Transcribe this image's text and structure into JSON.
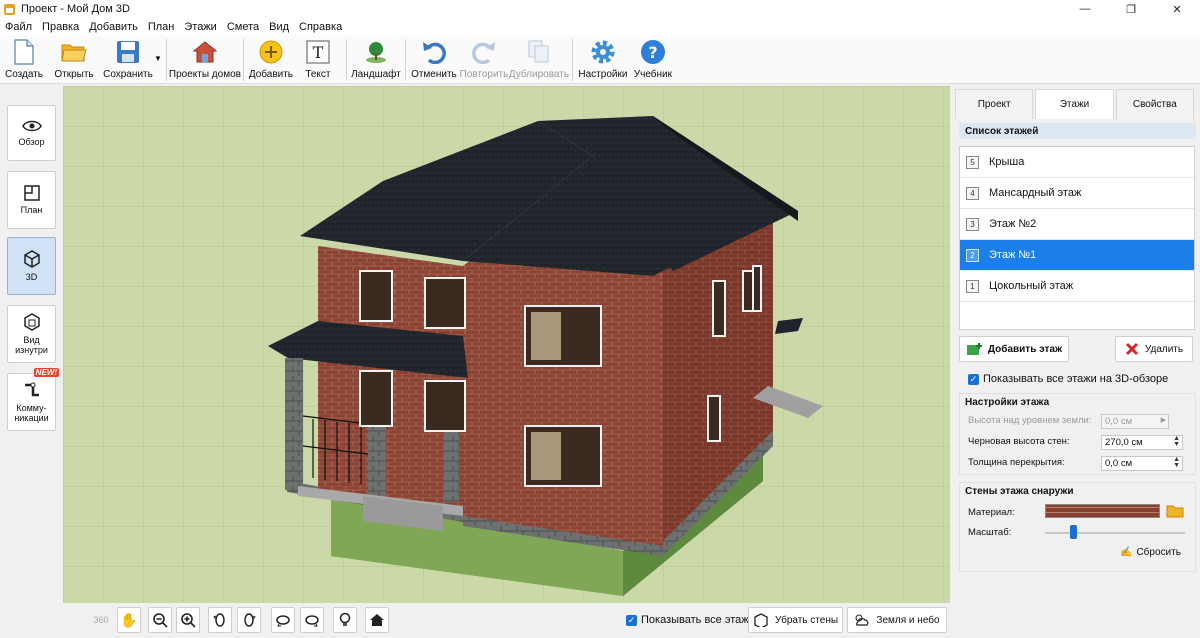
{
  "window": {
    "title": "Проект - Мой Дом 3D"
  },
  "menu": [
    "Файл",
    "Правка",
    "Добавить",
    "План",
    "Этажи",
    "Смета",
    "Вид",
    "Справка"
  ],
  "toolbar": {
    "create": "Создать",
    "open": "Открыть",
    "save": "Сохранить",
    "house_projects": "Проекты домов",
    "add": "Добавить",
    "text": "Текст",
    "landscape": "Ландшафт",
    "undo": "Отменить",
    "redo": "Повторить",
    "duplicate": "Дублировать",
    "settings": "Настройки",
    "tutorial": "Учебник"
  },
  "left_panel": {
    "overview": "Обзор",
    "plan": "План",
    "view3d": "3D",
    "inside_line1": "Вид",
    "inside_line2": "изнутри",
    "comm_line1": "Комму-",
    "comm_line2": "никации",
    "new_badge": "NEW!"
  },
  "bottom_bar": {
    "show_all_floors": "Показывать все этажи",
    "remove_walls": "Убрать стены",
    "ground_sky": "Земля и небо"
  },
  "right_panel": {
    "tabs": [
      "Проект",
      "Этажи",
      "Свойства"
    ],
    "active_tab": "Этажи",
    "floor_list_title": "Список этажей",
    "floors": [
      {
        "num": "5",
        "name": "Крыша"
      },
      {
        "num": "4",
        "name": "Мансардный этаж"
      },
      {
        "num": "3",
        "name": "Этаж №2"
      },
      {
        "num": "2",
        "name": "Этаж №1"
      },
      {
        "num": "1",
        "name": "Цокольный этаж"
      }
    ],
    "selected_floor": "Этаж №1",
    "add_floor": "Добавить этаж",
    "delete": "Удалить",
    "show_all_in_3d": "Показывать все этажи на 3D-обзоре",
    "floor_settings_title": "Настройки этажа",
    "height_above_ground_label": "Высота над уровнем земли:",
    "height_above_ground_value": "0,0 см",
    "wall_height_label": "Черновая высота стен:",
    "wall_height_value": "270,0 см",
    "slab_thickness_label": "Толщина перекрытия:",
    "slab_thickness_value": "0,0 см",
    "outer_walls_title": "Стены этажа снаружи",
    "material_label": "Материал:",
    "scale_label": "Масштаб:",
    "reset": "Сбросить",
    "scale_level": 0.2,
    "material_color": "#8a4030"
  },
  "colors": {
    "accent": "#1a7fe6",
    "brick": "#8a4030",
    "roof": "#1d2128",
    "ground": "#c8d6a4"
  }
}
